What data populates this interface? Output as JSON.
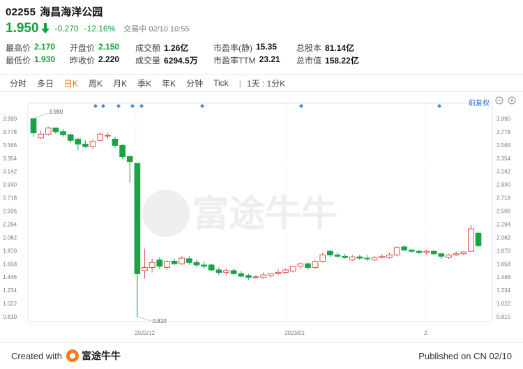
{
  "header": {
    "code": "02255",
    "name": "海昌海洋公园",
    "price": "1.950",
    "change": "-0.270",
    "change_pct": "-12.16%",
    "status": "交易中 02/10 10:55"
  },
  "stats": [
    [
      {
        "label": "最高价",
        "value": "2.170",
        "green": true
      },
      {
        "label": "开盘价",
        "value": "2.150",
        "green": true
      },
      {
        "label": "成交额",
        "value": "1.26亿"
      },
      {
        "label": "市盈率(静)",
        "value": "15.35"
      },
      {
        "label": "总股本",
        "value": "81.14亿"
      }
    ],
    [
      {
        "label": "最低价",
        "value": "1.930",
        "green": true
      },
      {
        "label": "昨收价",
        "value": "2.220"
      },
      {
        "label": "成交量",
        "value": "6294.5万"
      },
      {
        "label": "市盈率TTM",
        "value": "23.21"
      },
      {
        "label": "总市值",
        "value": "158.22亿"
      }
    ]
  ],
  "tabs": [
    "分时",
    "多日",
    "日K",
    "周K",
    "月K",
    "季K",
    "年K",
    "分钟",
    "Tick"
  ],
  "active_tab": 2,
  "tab_extra": "1天 : 1分K",
  "adjust_label": "前复权",
  "chart_data": {
    "type": "candlestick",
    "y_ticks": [
      "3.990",
      "3.778",
      "3.566",
      "3.354",
      "3.142",
      "2.930",
      "2.718",
      "2.506",
      "2.294",
      "2.082",
      "1.870",
      "1.658",
      "1.446",
      "1.234",
      "1.022",
      "0.810"
    ],
    "ylim": [
      0.81,
      3.99
    ],
    "x_labels": [
      "2022/12",
      "2023/01",
      "2"
    ],
    "annotations": [
      {
        "text": "3.990"
      },
      {
        "text": "0.810"
      }
    ],
    "up_color": "#e0514f",
    "down_color": "#1aa346",
    "watermark": "富途牛牛",
    "candles": [
      {
        "o": 3.99,
        "h": 3.99,
        "l": 3.7,
        "c": 3.76
      },
      {
        "o": 3.68,
        "h": 3.8,
        "l": 3.66,
        "c": 3.74
      },
      {
        "o": 3.74,
        "h": 3.86,
        "l": 3.72,
        "c": 3.84
      },
      {
        "o": 3.84,
        "h": 3.84,
        "l": 3.74,
        "c": 3.78
      },
      {
        "o": 3.78,
        "h": 3.82,
        "l": 3.7,
        "c": 3.73
      },
      {
        "o": 3.73,
        "h": 3.75,
        "l": 3.6,
        "c": 3.64
      },
      {
        "o": 3.66,
        "h": 3.68,
        "l": 3.48,
        "c": 3.58
      },
      {
        "o": 3.58,
        "h": 3.64,
        "l": 3.52,
        "c": 3.54
      },
      {
        "o": 3.54,
        "h": 3.66,
        "l": 3.5,
        "c": 3.62
      },
      {
        "o": 3.64,
        "h": 3.78,
        "l": 3.62,
        "c": 3.74
      },
      {
        "o": 3.72,
        "h": 3.76,
        "l": 3.66,
        "c": 3.72
      },
      {
        "o": 3.66,
        "h": 3.7,
        "l": 3.52,
        "c": 3.56
      },
      {
        "o": 3.56,
        "h": 3.58,
        "l": 3.34,
        "c": 3.38
      },
      {
        "o": 3.38,
        "h": 3.4,
        "l": 2.96,
        "c": 3.3
      },
      {
        "o": 3.27,
        "h": 3.27,
        "l": 0.81,
        "c": 1.5
      },
      {
        "o": 1.55,
        "h": 1.9,
        "l": 1.42,
        "c": 1.6
      },
      {
        "o": 1.6,
        "h": 1.74,
        "l": 1.52,
        "c": 1.68
      },
      {
        "o": 1.72,
        "h": 1.76,
        "l": 1.58,
        "c": 1.62
      },
      {
        "o": 1.6,
        "h": 1.72,
        "l": 1.56,
        "c": 1.7
      },
      {
        "o": 1.7,
        "h": 1.74,
        "l": 1.64,
        "c": 1.66
      },
      {
        "o": 1.66,
        "h": 1.78,
        "l": 1.64,
        "c": 1.75
      },
      {
        "o": 1.74,
        "h": 1.78,
        "l": 1.64,
        "c": 1.68
      },
      {
        "o": 1.68,
        "h": 1.72,
        "l": 1.6,
        "c": 1.64
      },
      {
        "o": 1.64,
        "h": 1.7,
        "l": 1.58,
        "c": 1.62
      },
      {
        "o": 1.64,
        "h": 1.66,
        "l": 1.54,
        "c": 1.56
      },
      {
        "o": 1.56,
        "h": 1.6,
        "l": 1.48,
        "c": 1.52
      },
      {
        "o": 1.52,
        "h": 1.58,
        "l": 1.48,
        "c": 1.55
      },
      {
        "o": 1.55,
        "h": 1.58,
        "l": 1.48,
        "c": 1.5
      },
      {
        "o": 1.5,
        "h": 1.54,
        "l": 1.44,
        "c": 1.46
      },
      {
        "o": 1.47,
        "h": 1.5,
        "l": 1.4,
        "c": 1.44
      },
      {
        "o": 1.44,
        "h": 1.48,
        "l": 1.42,
        "c": 1.45
      },
      {
        "o": 1.44,
        "h": 1.52,
        "l": 1.42,
        "c": 1.48
      },
      {
        "o": 1.47,
        "h": 1.5,
        "l": 1.44,
        "c": 1.5
      },
      {
        "o": 1.5,
        "h": 1.58,
        "l": 1.48,
        "c": 1.52
      },
      {
        "o": 1.52,
        "h": 1.58,
        "l": 1.5,
        "c": 1.56
      },
      {
        "o": 1.54,
        "h": 1.62,
        "l": 1.52,
        "c": 1.62
      },
      {
        "o": 1.62,
        "h": 1.68,
        "l": 1.58,
        "c": 1.66
      },
      {
        "o": 1.66,
        "h": 1.68,
        "l": 1.56,
        "c": 1.6
      },
      {
        "o": 1.6,
        "h": 1.72,
        "l": 1.58,
        "c": 1.7
      },
      {
        "o": 1.7,
        "h": 1.84,
        "l": 1.68,
        "c": 1.8
      },
      {
        "o": 1.86,
        "h": 1.88,
        "l": 1.76,
        "c": 1.8
      },
      {
        "o": 1.8,
        "h": 1.84,
        "l": 1.76,
        "c": 1.78
      },
      {
        "o": 1.78,
        "h": 1.82,
        "l": 1.74,
        "c": 1.76
      },
      {
        "o": 1.72,
        "h": 1.8,
        "l": 1.7,
        "c": 1.77
      },
      {
        "o": 1.77,
        "h": 1.8,
        "l": 1.72,
        "c": 1.75
      },
      {
        "o": 1.75,
        "h": 1.8,
        "l": 1.7,
        "c": 1.74
      },
      {
        "o": 1.72,
        "h": 1.78,
        "l": 1.7,
        "c": 1.76
      },
      {
        "o": 1.76,
        "h": 1.82,
        "l": 1.74,
        "c": 1.78
      },
      {
        "o": 1.76,
        "h": 1.84,
        "l": 1.74,
        "c": 1.8
      },
      {
        "o": 1.8,
        "h": 1.94,
        "l": 1.78,
        "c": 1.92
      },
      {
        "o": 1.93,
        "h": 1.96,
        "l": 1.86,
        "c": 1.88
      },
      {
        "o": 1.88,
        "h": 1.9,
        "l": 1.84,
        "c": 1.86
      },
      {
        "o": 1.86,
        "h": 1.88,
        "l": 1.82,
        "c": 1.84
      },
      {
        "o": 1.84,
        "h": 1.88,
        "l": 1.8,
        "c": 1.86
      },
      {
        "o": 1.86,
        "h": 1.88,
        "l": 1.8,
        "c": 1.82
      },
      {
        "o": 1.82,
        "h": 1.84,
        "l": 1.74,
        "c": 1.78
      },
      {
        "o": 1.76,
        "h": 1.82,
        "l": 1.74,
        "c": 1.8
      },
      {
        "o": 1.8,
        "h": 1.86,
        "l": 1.78,
        "c": 1.82
      },
      {
        "o": 1.82,
        "h": 1.86,
        "l": 1.8,
        "c": 1.85
      },
      {
        "o": 1.86,
        "h": 2.28,
        "l": 1.86,
        "c": 2.22
      },
      {
        "o": 2.15,
        "h": 2.17,
        "l": 1.93,
        "c": 1.95
      }
    ]
  },
  "footer": {
    "created_with": "Created with",
    "brand": "富途牛牛",
    "published": "Published on CN 02/10"
  }
}
